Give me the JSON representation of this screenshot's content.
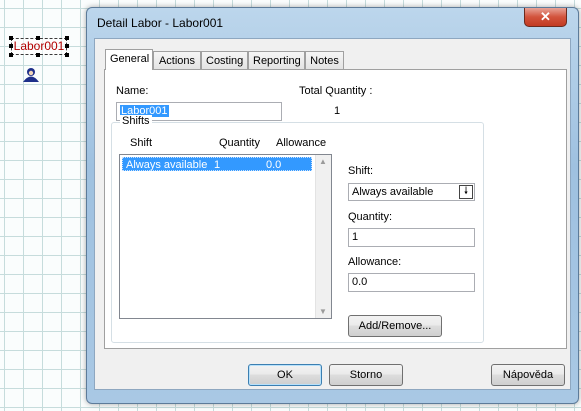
{
  "canvas": {
    "object_label": "Labor001",
    "object_icon": "worker-icon"
  },
  "dialog": {
    "title": "Detail Labor - Labor001",
    "close_glyph": "✕",
    "tabs": [
      "General",
      "Actions",
      "Costing",
      "Reporting",
      "Notes"
    ],
    "active_tab": "General",
    "name_label": "Name:",
    "name_value": "Labor001",
    "total_quantity_label": "Total Quantity :",
    "total_quantity_value": "1",
    "shifts": {
      "title": "Shifts",
      "columns": [
        "Shift",
        "Quantity",
        "Allowance"
      ],
      "rows": [
        {
          "shift": "Always available",
          "quantity": "1",
          "allowance": "0.0"
        }
      ],
      "shift_label": "Shift:",
      "shift_value": "Always available",
      "quantity_label": "Quantity:",
      "quantity_value": "1",
      "allowance_label": "Allowance:",
      "allowance_value": "0.0",
      "add_remove_label": "Add/Remove..."
    },
    "buttons": {
      "ok": "OK",
      "cancel": "Storno",
      "help": "Nápověda"
    }
  },
  "colors": {
    "selection": "#3399ff",
    "object_label": "#b20000",
    "close_button": "#c23a22"
  }
}
